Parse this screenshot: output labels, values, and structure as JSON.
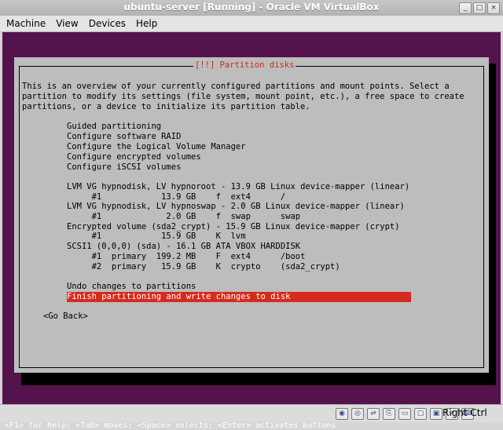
{
  "window": {
    "title": "ubuntu-server [Running] - Oracle VM VirtualBox"
  },
  "menu": [
    "Machine",
    "View",
    "Devices",
    "Help"
  ],
  "dialog": {
    "title": "[!!] Partition disks",
    "intro": [
      "This is an overview of your currently configured partitions and mount points. Select a",
      "partition to modify its settings (file system, mount point, etc.), a free space to create",
      "partitions, or a device to initialize its partition table."
    ],
    "actions": [
      "Guided partitioning",
      "Configure software RAID",
      "Configure the Logical Volume Manager",
      "Configure encrypted volumes",
      "Configure iSCSI volumes"
    ],
    "partitions": [
      "LVM VG hypnodisk, LV hypnoroot - 13.9 GB Linux device-mapper (linear)",
      "     #1            13.9 GB    f  ext4      /",
      "LVM VG hypnodisk, LV hypnoswap - 2.0 GB Linux device-mapper (linear)",
      "     #1             2.0 GB    f  swap      swap",
      "Encrypted volume (sda2_crypt) - 15.9 GB Linux device-mapper (crypt)",
      "     #1            15.9 GB    K  lvm",
      "SCSI1 (0,0,0) (sda) - 16.1 GB ATA VBOX HARDDISK",
      "     #1  primary  199.2 MB    F  ext4      /boot",
      "     #2  primary   15.9 GB    K  crypto    (sda2_crypt)"
    ],
    "undo": "Undo changes to partitions",
    "finish": "Finish partitioning and write changes to disk",
    "back": "<Go Back>"
  },
  "help_line": "<F1> for help; <Tab> moves; <Space> selects; <Enter> activates buttons",
  "statusbar": {
    "host_key": "Right Ctrl"
  }
}
